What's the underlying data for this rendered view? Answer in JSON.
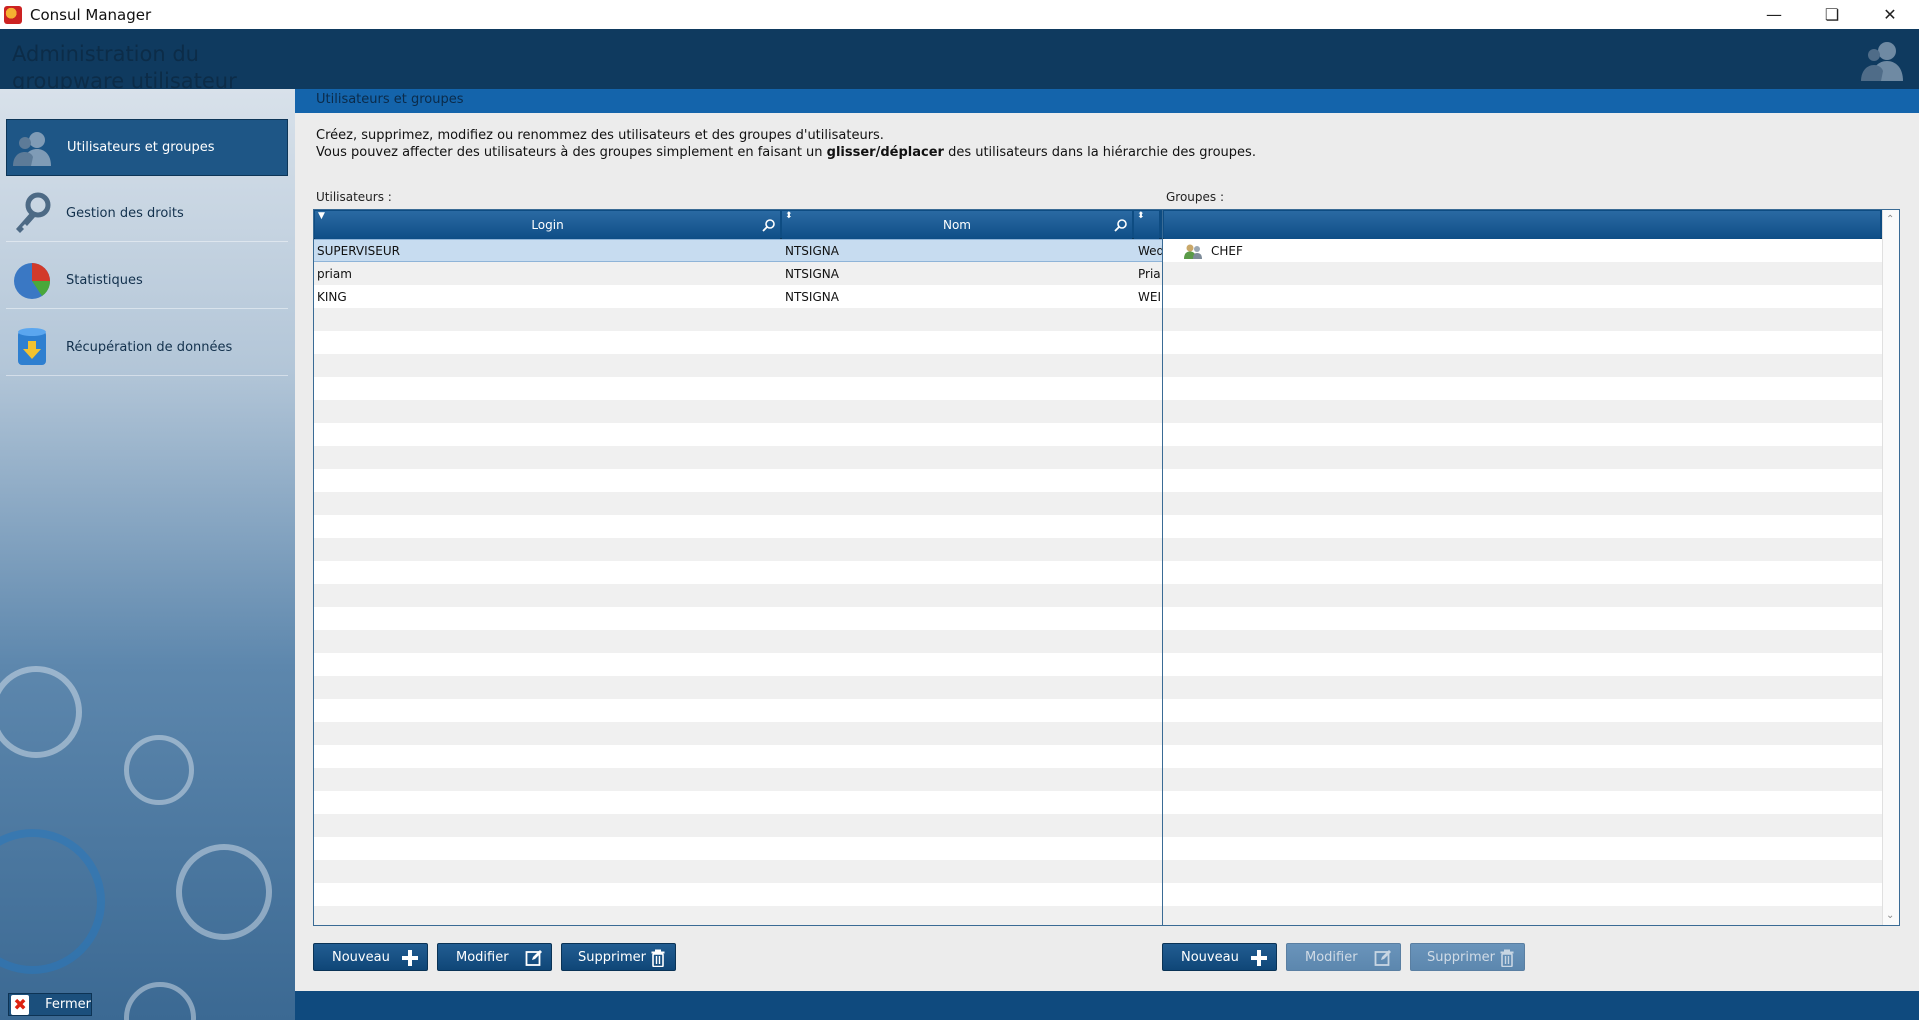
{
  "window": {
    "title": "Consul Manager",
    "controls": [
      "minimize",
      "restore",
      "close"
    ]
  },
  "header": {
    "subtitle": "Administration du groupware utilisateur"
  },
  "sidebar": {
    "items": [
      {
        "label": "Utilisateurs et groupes",
        "icon": "users-icon",
        "active": true
      },
      {
        "label": "Gestion des droits",
        "icon": "key-icon",
        "active": false
      },
      {
        "label": "Statistiques",
        "icon": "pie-chart-icon",
        "active": false
      },
      {
        "label": "Récupération de données",
        "icon": "database-download-icon",
        "active": false
      }
    ],
    "close_label": "Fermer"
  },
  "main": {
    "section_title": "Utilisateurs et groupes",
    "description_line1": "Créez, supprimez, modifiez ou renommez des utilisateurs et des groupes d'utilisateurs.",
    "description_line2_before": "Vous pouvez affecter des utilisateurs à des groupes simplement en faisant un ",
    "description_line2_bold": "glisser/déplacer",
    "description_line2_after": " des utilisateurs dans la hiérarchie des groupes.",
    "users_label": "Utilisateurs :",
    "groups_label": "Groupes :",
    "users_columns": [
      "Login",
      "Nom",
      ""
    ],
    "users_rows": [
      {
        "login": "SUPERVISEUR",
        "nom": "NTSIGNA",
        "extra": "Wed"
      },
      {
        "login": "priam",
        "nom": "NTSIGNA",
        "extra": "Pria"
      },
      {
        "login": "KING",
        "nom": "NTSIGNA",
        "extra": "WEI"
      }
    ],
    "groups": [
      {
        "name": "CHEF"
      }
    ],
    "users_buttons": {
      "new": "Nouveau",
      "edit": "Modifier",
      "delete": "Supprimer"
    },
    "groups_buttons": {
      "new": "Nouveau",
      "edit": "Modifier",
      "delete": "Supprimer"
    }
  },
  "colors": {
    "header": "#0f3a5f",
    "accent": "#1464ab",
    "button": "#0f4677",
    "selected_row": "#c7dcf0"
  }
}
